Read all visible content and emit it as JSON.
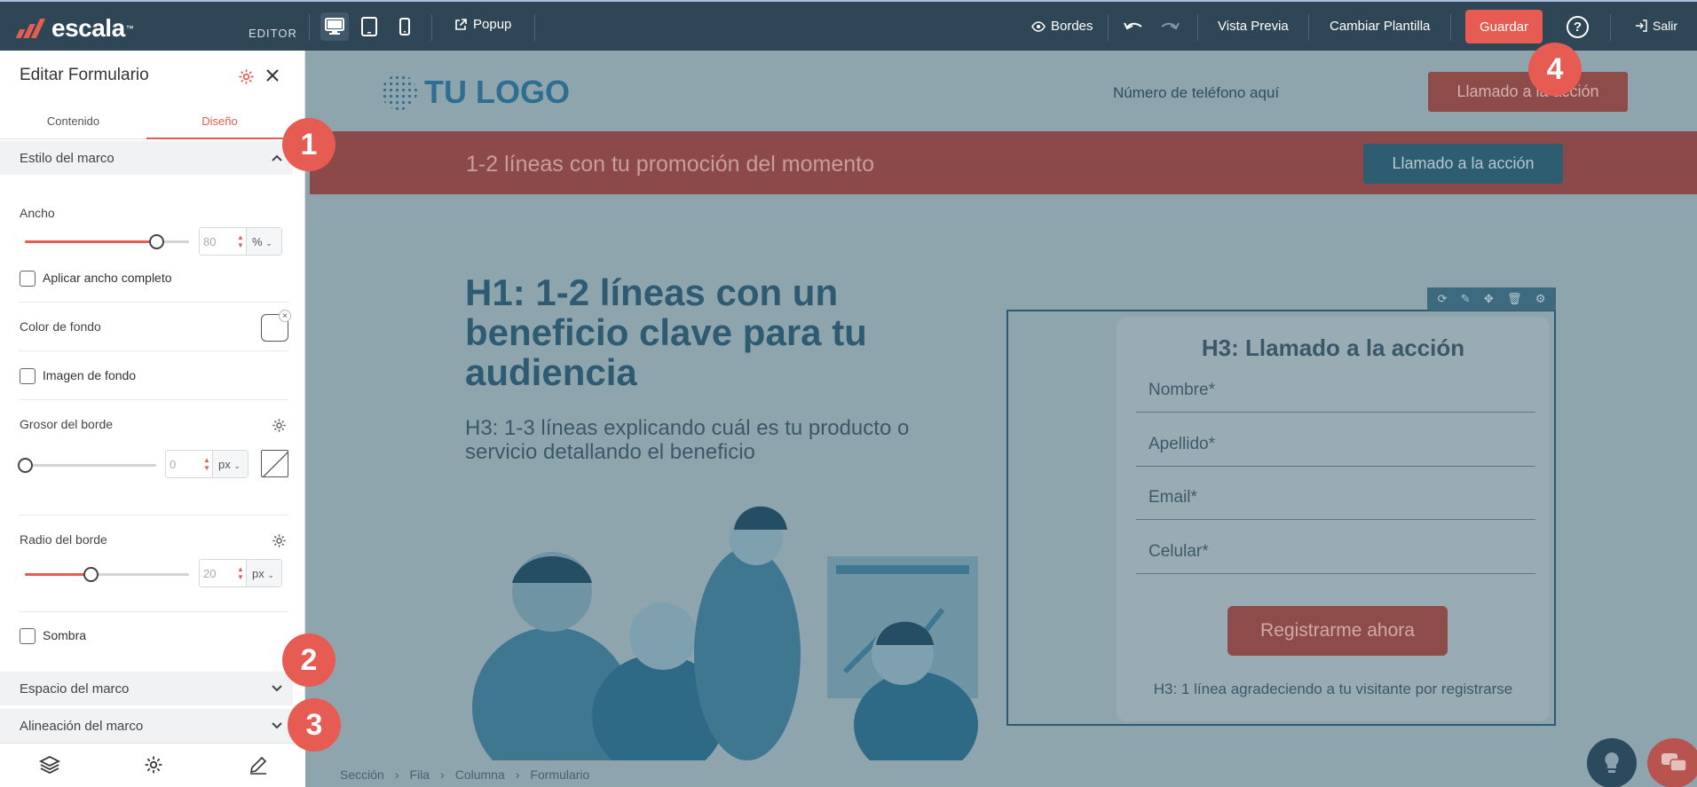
{
  "topbar": {
    "brand": "escala",
    "brand_tm": "™",
    "editor_label": "EDITOR",
    "popup_label": "Popup",
    "bordes_label": "Bordes",
    "preview_label": "Vista Previa",
    "template_label": "Cambiar Plantilla",
    "save_label": "Guardar",
    "help_label": "?",
    "exit_label": "Salir"
  },
  "panel": {
    "title": "Editar Formulario",
    "tabs": [
      {
        "label": "Contenido",
        "active": false
      },
      {
        "label": "Diseño",
        "active": true
      }
    ],
    "section_frame_style": "Estilo del marco",
    "width": {
      "label": "Ancho",
      "value": "80",
      "unit": "%",
      "slider_fraction": 0.8
    },
    "full_width_label": "Aplicar ancho completo",
    "bg_color_label": "Color de fondo",
    "bg_image_label": "Imagen de fondo",
    "border_width": {
      "label": "Grosor del borde",
      "value": "0",
      "unit": "px",
      "slider_fraction": 0.0
    },
    "border_radius": {
      "label": "Radio del borde",
      "value": "20",
      "unit": "px",
      "slider_fraction": 0.4
    },
    "shadow_label": "Sombra",
    "section_spacing": "Espacio del marco",
    "section_alignment": "Alineación del marco"
  },
  "page": {
    "logo_text": "TU LOGO",
    "phone_text": "Número de teléfono aquí",
    "cta_top": "Llamado a la acción",
    "promo_text": "1-2 líneas con tu promoción del momento",
    "promo_cta": "Llamado a la acción",
    "hero_h1": "H1: 1-2 líneas con un beneficio clave para tu audiencia",
    "hero_h3": "H3: 1-3 líneas explicando cuál es tu producto o servicio detallando el beneficio",
    "form": {
      "title": "H3: Llamado a la acción",
      "fields": [
        "Nombre*",
        "Apellido*",
        "Email*",
        "Celular*"
      ],
      "submit": "Registrarme ahora",
      "thanks": "H3: 1 línea agradeciendo a tu visitante por registrarse"
    }
  },
  "breadcrumb": [
    "Sección",
    "Fila",
    "Columna",
    "Formulario"
  ],
  "markers": [
    "1",
    "2",
    "3",
    "4"
  ],
  "colors": {
    "accent": "#e65b52",
    "topbar": "#2e4656",
    "overlay": "#8fa5ad"
  }
}
